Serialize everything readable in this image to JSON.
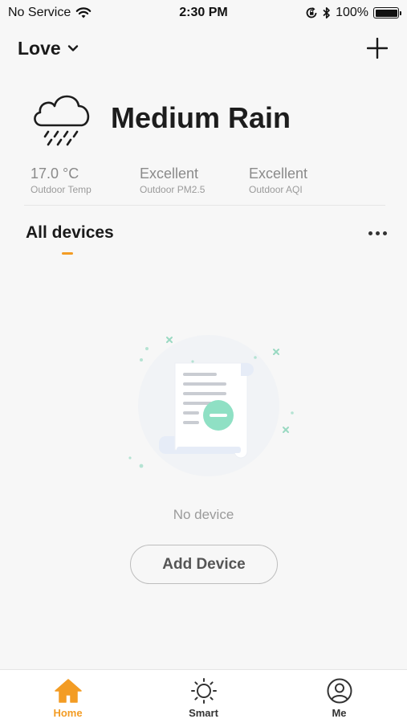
{
  "status_bar": {
    "carrier": "No Service",
    "time": "2:30 PM",
    "battery": "100%"
  },
  "header": {
    "home_name": "Love"
  },
  "weather": {
    "condition": "Medium Rain",
    "metrics": [
      {
        "value": "17.0 °C",
        "label": "Outdoor Temp"
      },
      {
        "value": "Excellent",
        "label": "Outdoor PM2.5"
      },
      {
        "value": "Excellent",
        "label": "Outdoor AQI"
      }
    ]
  },
  "devices": {
    "title": "All devices",
    "empty_text": "No device",
    "add_button": "Add Device"
  },
  "tab_bar": {
    "tabs": [
      {
        "label": "Home",
        "icon": "home-icon",
        "active": true
      },
      {
        "label": "Smart",
        "icon": "sun-icon",
        "active": false
      },
      {
        "label": "Me",
        "icon": "user-icon",
        "active": false
      }
    ]
  },
  "colors": {
    "accent": "#f39c24",
    "background": "#f7f7f7",
    "illustration_accent": "#8fe0c4"
  }
}
